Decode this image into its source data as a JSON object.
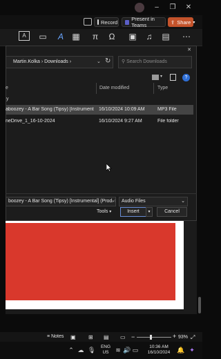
{
  "topbar": {
    "avatar_icon": "user-avatar-icon",
    "minimize": "–",
    "restore": "❐",
    "close": "✕"
  },
  "actions": {
    "record_label": "Record",
    "teams_label": "Present in Teams",
    "share_label": "Share"
  },
  "dialog": {
    "path": [
      "Martin.Kolka",
      "Downloads"
    ],
    "search_placeholder": "Search Downloads",
    "columns": {
      "name": "e",
      "date": "Date modified",
      "type": "Type"
    },
    "group_label": "y",
    "files": [
      {
        "name": "aboozey - A Bar Song (Tipsy) [Instrumental] (...",
        "date": "16/10/2024 10:09 AM",
        "type": "MP3 File",
        "selected": true
      },
      {
        "name": "neDrive_1_16-10-2024",
        "date": "16/10/2024 9:27 AM",
        "type": "File folder",
        "selected": false
      }
    ],
    "filename_value": "boozey - A Bar Song (Tipsy) [Instrumental] (Prod. By Nev",
    "filetype_value": "Audio Files",
    "tools_label": "Tools",
    "insert_label": "Insert",
    "cancel_label": "Cancel",
    "close_icon": "✕"
  },
  "statusbar": {
    "notes_label": "Notes",
    "zoom": "93%"
  },
  "taskbar": {
    "lang_line1": "ENG",
    "lang_line2": "US",
    "time": "10:36 AM",
    "date": "16/10/2024"
  },
  "colors": {
    "accent_share": "#c4532b",
    "slide_red": "#d9382c",
    "selected_row": "#444444"
  }
}
